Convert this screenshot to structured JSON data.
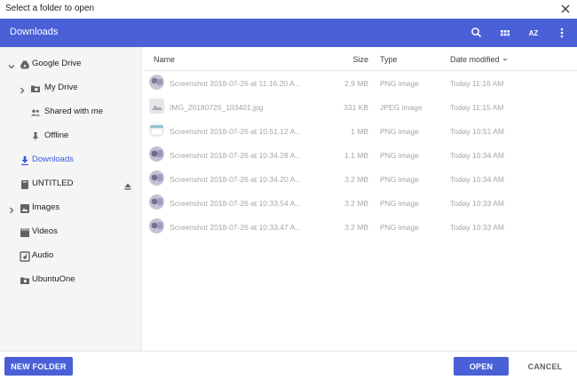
{
  "window": {
    "title": "Select a folder to open"
  },
  "toolbar": {
    "location": "Downloads",
    "icons": [
      "search-icon",
      "grid-view-icon",
      "sort-az-icon",
      "more-vert-icon"
    ],
    "az_label": "AZ"
  },
  "sidebar": {
    "items": [
      {
        "label": "Google Drive",
        "icon": "drive-icon"
      },
      {
        "label": "My Drive",
        "icon": "folder-icon"
      },
      {
        "label": "Shared with me",
        "icon": "people-icon"
      },
      {
        "label": "Offline",
        "icon": "pin-icon"
      },
      {
        "label": "Downloads",
        "icon": "download-icon",
        "selected": true
      },
      {
        "label": "UNTITLED",
        "icon": "drive-disk-icon"
      },
      {
        "label": "Images",
        "icon": "image-icon"
      },
      {
        "label": "Videos",
        "icon": "video-icon"
      },
      {
        "label": "Audio",
        "icon": "audio-icon"
      },
      {
        "label": "UbuntuOne",
        "icon": "folder-shared-icon"
      }
    ]
  },
  "list": {
    "columns": {
      "name": "Name",
      "size": "Size",
      "type": "Type",
      "date": "Date modified"
    },
    "files": [
      {
        "name": "Screenshot 2018-07-26 at 11.16.20 A...",
        "size": "2.9 MB",
        "type": "PNG image",
        "date": "Today 11:16 AM"
      },
      {
        "name": "IMG_20180726_103401.jpg",
        "size": "331 KB",
        "type": "JPEG image",
        "date": "Today 11:15 AM"
      },
      {
        "name": "Screenshot 2018-07-26 at 10.51.12 A...",
        "size": "1 MB",
        "type": "PNG image",
        "date": "Today 10:51 AM"
      },
      {
        "name": "Screenshot 2018-07-26 at 10.34.28 A...",
        "size": "1.1 MB",
        "type": "PNG image",
        "date": "Today 10:34 AM"
      },
      {
        "name": "Screenshot 2018-07-26 at 10.34.20 A...",
        "size": "3.2 MB",
        "type": "PNG image",
        "date": "Today 10:34 AM"
      },
      {
        "name": "Screenshot 2018-07-26 at 10.33.54 A...",
        "size": "3.2 MB",
        "type": "PNG image",
        "date": "Today 10:33 AM"
      },
      {
        "name": "Screenshot 2018-07-26 at 10.33.47 A...",
        "size": "3.2 MB",
        "type": "PNG image",
        "date": "Today 10:33 AM"
      }
    ]
  },
  "footer": {
    "new_folder_label": "NEW FOLDER",
    "open_label": "OPEN",
    "cancel_label": "CANCEL"
  },
  "colors": {
    "accent": "#4a60d7",
    "selected_text": "#3b5bdb",
    "sidebar_bg": "#f5f5f5",
    "muted_text": "#a4a6ab"
  }
}
